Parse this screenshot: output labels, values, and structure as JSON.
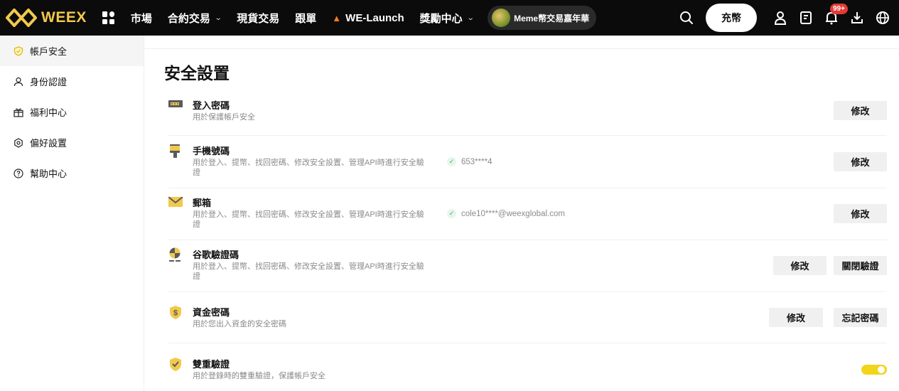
{
  "brand": {
    "name": "WEEX",
    "color": "#f2c94c"
  },
  "nav": {
    "items": [
      {
        "label": "市場",
        "dropdown": false
      },
      {
        "label": "合約交易",
        "dropdown": true
      },
      {
        "label": "現貨交易",
        "dropdown": false
      },
      {
        "label": "跟單",
        "dropdown": false
      },
      {
        "label": "WE-Launch",
        "dropdown": false,
        "icon": "fire-icon"
      },
      {
        "label": "獎勵中心",
        "dropdown": true
      }
    ],
    "promo_label": "Meme幣交易嘉年華",
    "deposit_label": "充幣",
    "notification_badge": "99+"
  },
  "sidebar": {
    "items": [
      {
        "label": "帳戶安全",
        "icon": "shield-icon",
        "active": true
      },
      {
        "label": "身份認證",
        "icon": "user-icon",
        "active": false
      },
      {
        "label": "福利中心",
        "icon": "gift-icon",
        "active": false
      },
      {
        "label": "偏好設置",
        "icon": "settings-icon",
        "active": false
      },
      {
        "label": "幫助中心",
        "icon": "help-icon",
        "active": false
      }
    ]
  },
  "main": {
    "title": "安全設置",
    "rows": [
      {
        "title": "登入密碼",
        "desc": "用於保護帳戶安全",
        "status": "",
        "buttons": [
          "修改"
        ]
      },
      {
        "title": "手機號碼",
        "desc": "用於登入、提幣、找回密碼、修改安全設置、管理API時進行安全驗證",
        "status": "653****4",
        "buttons": [
          "修改"
        ]
      },
      {
        "title": "郵箱",
        "desc": "用於登入、提幣、找回密碼、修改安全設置、管理API時進行安全驗證",
        "status": "cole10****@weexglobal.com",
        "buttons": [
          "修改"
        ]
      },
      {
        "title": "谷歌驗證碼",
        "desc": "用於登入、提幣、找回密碼、修改安全設置、管理API時進行安全驗證",
        "status": "",
        "buttons": [
          "修改",
          "關閉驗證"
        ]
      },
      {
        "title": "資金密碼",
        "desc": "用於您出入資金的安全密碼",
        "status": "",
        "buttons": [
          "修改",
          "忘記密碼"
        ]
      },
      {
        "title": "雙重驗證",
        "desc": "用於登錄時的雙重驗證，保護帳戶安全",
        "status": "",
        "buttons": [],
        "toggle_on": true
      }
    ]
  },
  "colors": {
    "accent": "#f2d51b",
    "verified": "#2db46d"
  }
}
